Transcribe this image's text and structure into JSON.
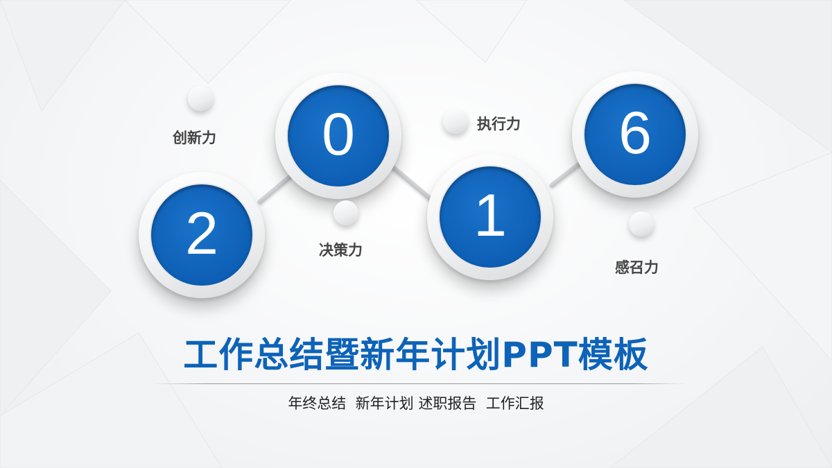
{
  "colors": {
    "accent_blue": "#0d63b8",
    "keyword_gray": "#444444",
    "subtitle_text": "#222222"
  },
  "steps": [
    {
      "digit": "2"
    },
    {
      "digit": "0"
    },
    {
      "digit": "1"
    },
    {
      "digit": "6"
    }
  ],
  "keywords": [
    {
      "label": "创新力"
    },
    {
      "label": "决策力"
    },
    {
      "label": "执行力"
    },
    {
      "label": "感召力"
    }
  ],
  "title": "工作总结暨新年计划PPT模板",
  "subtitle": "年终总结  新年计划 述职报告  工作汇报"
}
